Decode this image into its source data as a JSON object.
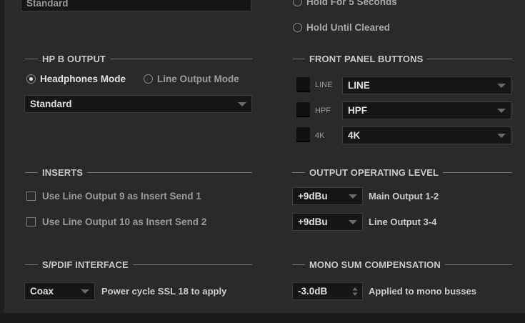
{
  "top": {
    "standard_select_value": "Standard",
    "hold_5_seconds_label": "Hold For 5 Seconds",
    "hold_until_cleared_label": "Hold Until Cleared"
  },
  "hp_b_output": {
    "title": "HP B OUTPUT",
    "headphones_mode_label": "Headphones Mode",
    "line_output_mode_label": "Line Output Mode",
    "selected_mode": "Headphones Mode",
    "select_value": "Standard"
  },
  "front_panel_buttons": {
    "title": "FRONT PANEL BUTTONS",
    "buttons": [
      {
        "label": "LINE",
        "value": "LINE"
      },
      {
        "label": "HPF",
        "value": "HPF"
      },
      {
        "label": "4K",
        "value": "4K"
      }
    ]
  },
  "inserts": {
    "title": "INSERTS",
    "items": [
      {
        "label": "Use Line Output 9 as Insert Send 1",
        "checked": false
      },
      {
        "label": "Use Line Output 10 as Insert Send 2",
        "checked": false
      }
    ]
  },
  "output_operating_level": {
    "title": "OUTPUT OPERATING LEVEL",
    "rows": [
      {
        "value": "+9dBu",
        "label": "Main Output 1-2"
      },
      {
        "value": "+9dBu",
        "label": "Line Output 3-4"
      }
    ]
  },
  "spdif": {
    "title": "S/PDIF INTERFACE",
    "value": "Coax",
    "note": "Power cycle SSL 18 to apply"
  },
  "mono_sum": {
    "title": "MONO SUM COMPENSATION",
    "value": "-3.0dB",
    "note": "Applied to mono busses"
  },
  "colors": {
    "background": "#2a2a2c",
    "field": "#161617",
    "text": "#cfcfcf"
  }
}
